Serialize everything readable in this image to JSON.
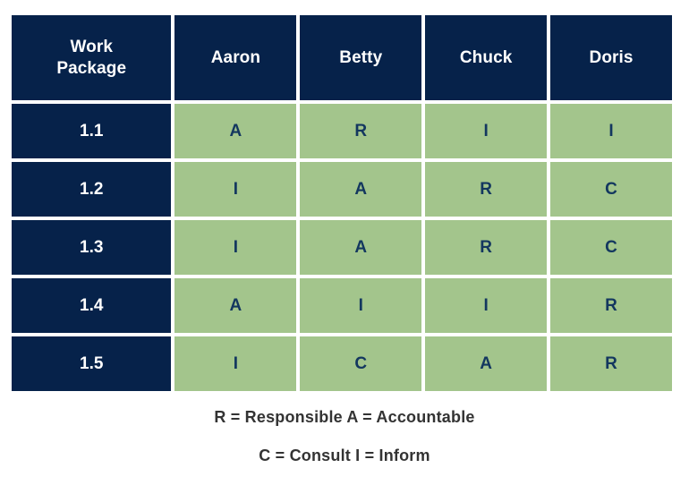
{
  "table": {
    "columns": [
      {
        "key": "work_package",
        "label": "Work Package",
        "label_line1": "Work",
        "label_line2": "Package"
      },
      {
        "key": "aaron",
        "label": "Aaron"
      },
      {
        "key": "betty",
        "label": "Betty"
      },
      {
        "key": "chuck",
        "label": "Chuck"
      },
      {
        "key": "doris",
        "label": "Doris"
      }
    ],
    "rows": [
      {
        "work_package": "1.1",
        "cells": [
          "A",
          "R",
          "I",
          "I"
        ]
      },
      {
        "work_package": "1.2",
        "cells": [
          "I",
          "A",
          "R",
          "C"
        ]
      },
      {
        "work_package": "1.3",
        "cells": [
          "I",
          "A",
          "R",
          "C"
        ]
      },
      {
        "work_package": "1.4",
        "cells": [
          "A",
          "I",
          "I",
          "R"
        ]
      },
      {
        "work_package": "1.5",
        "cells": [
          "I",
          "C",
          "A",
          "R"
        ]
      }
    ]
  },
  "legend": {
    "line1": "R = Responsible A = Accountable",
    "line2": "C = Consult  I = Inform",
    "entries": [
      {
        "code": "R",
        "meaning": "Responsible"
      },
      {
        "code": "A",
        "meaning": "Accountable"
      },
      {
        "code": "C",
        "meaning": "Consult"
      },
      {
        "code": "I",
        "meaning": "Inform"
      }
    ]
  },
  "colors": {
    "header_background": "#06224a",
    "row_label_background": "#06224a",
    "cell_background": "#a3c58c",
    "header_text": "#ffffff",
    "cell_text": "#13375f",
    "legend_text": "#333333",
    "page_background": "#ffffff"
  }
}
